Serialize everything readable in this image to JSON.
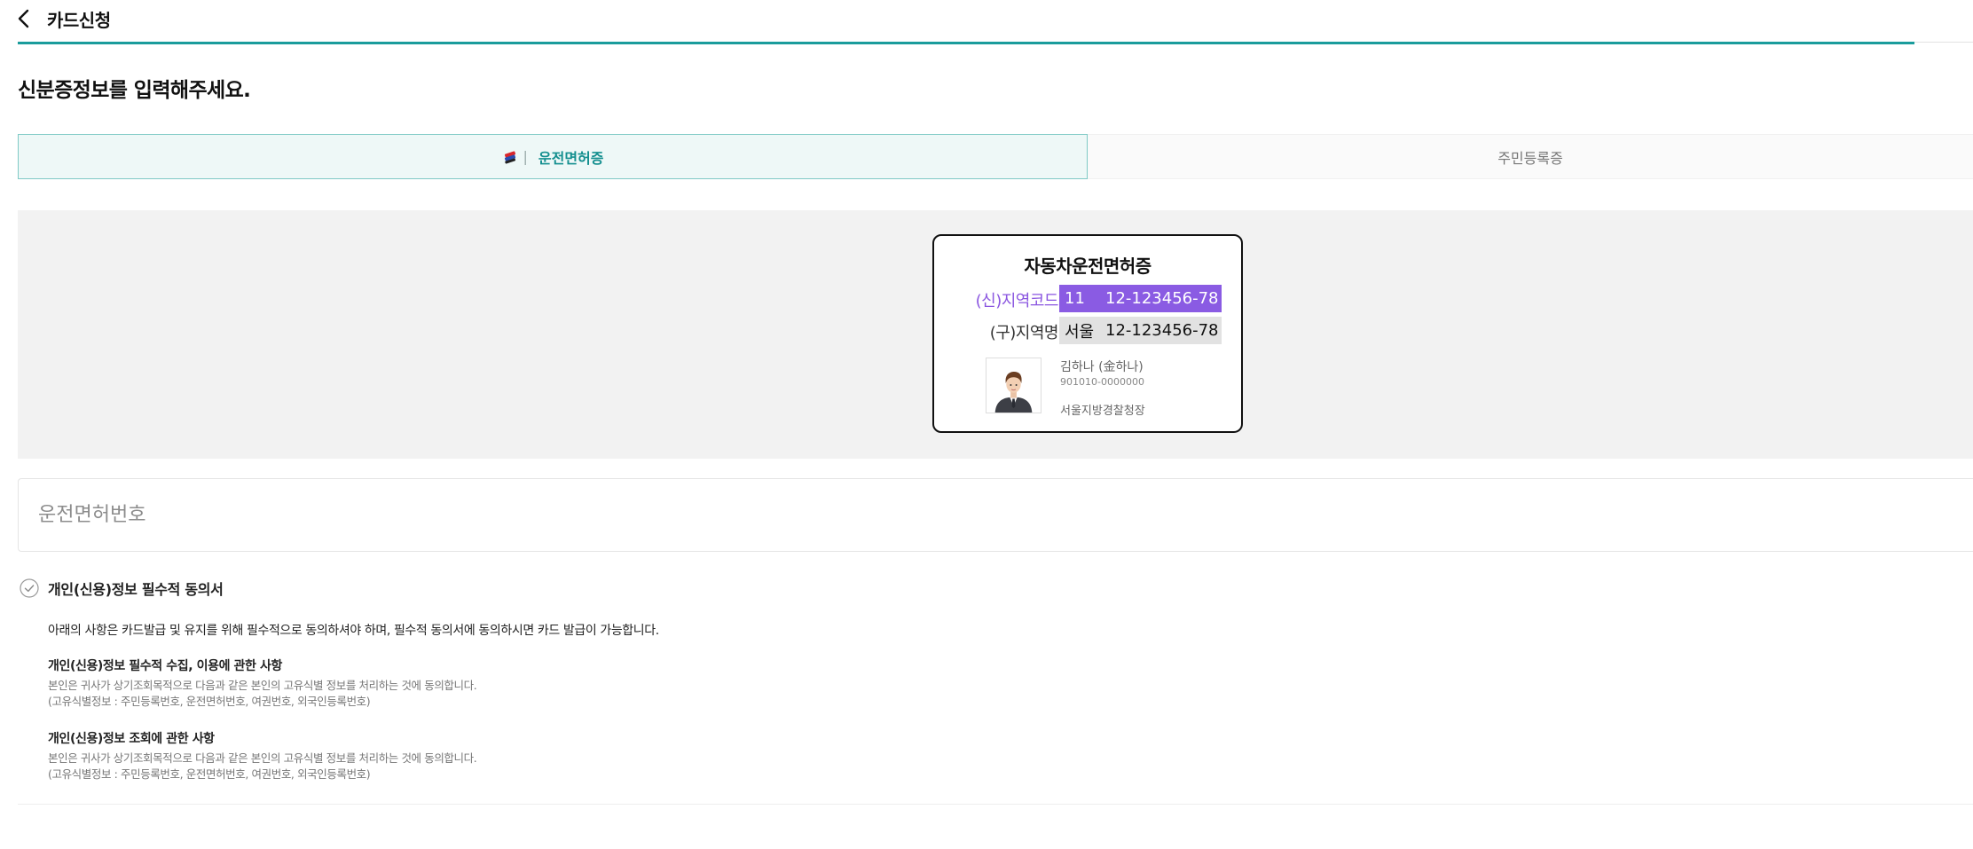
{
  "header": {
    "title": "카드신청",
    "progress_fraction": 0.97
  },
  "page": {
    "title": "신분증정보를 입력해주세요."
  },
  "tabs": [
    {
      "label": "운전면허증",
      "selected": true
    },
    {
      "label": "주민등록증",
      "selected": false
    }
  ],
  "card": {
    "title": "자동차운전면허증",
    "new_label": "(신)지역코드",
    "new_prefix": "11",
    "new_number": "12-123456-78",
    "old_label": "(구)지역명",
    "old_prefix": "서울",
    "old_number": "12-123456-78",
    "holder_name": "김하나 (金하나)",
    "holder_id": "901010-0000000",
    "issuer": "서울지방경찰청장"
  },
  "input": {
    "placeholder": "운전면허번호",
    "value": ""
  },
  "consent": {
    "label": "개인(신용)정보 필수적 동의서",
    "intro": "아래의 사항은 카드발급 및 유지를 위해 필수적으로 동의하셔야 하며, 필수적 동의서에 동의하시면 카드 발급이 가능합니다.",
    "sections": [
      {
        "title": "개인(신용)정보 필수적 수집, 이용에 관한 사항",
        "line1": "본인은 귀사가 상기조회목적으로 다음과 같은 본인의 고유식별 정보를 처리하는 것에 동의합니다.",
        "line2": "(고유식별정보 : 주민등록번호, 운전면허번호, 여권번호, 외국인등록번호)"
      },
      {
        "title": "개인(신용)정보 조회에 관한 사항",
        "line1": "본인은 귀사가 상기조회목적으로 다음과 같은 본인의 고유식별 정보를 처리하는 것에 동의합니다.",
        "line2": "(고유식별정보 : 주민등록번호, 운전면허번호, 여권번호, 외국인등록번호)"
      }
    ]
  },
  "colors": {
    "accent": "#1a9c9c",
    "tab_selected_bg": "#eef8f7",
    "region_code_bg": "#8a5be3"
  },
  "icons": {
    "back": "chevron-left-icon",
    "tab_license": "license-card-icon",
    "consent_check": "check-circle-icon",
    "photo": "person-avatar-icon"
  }
}
